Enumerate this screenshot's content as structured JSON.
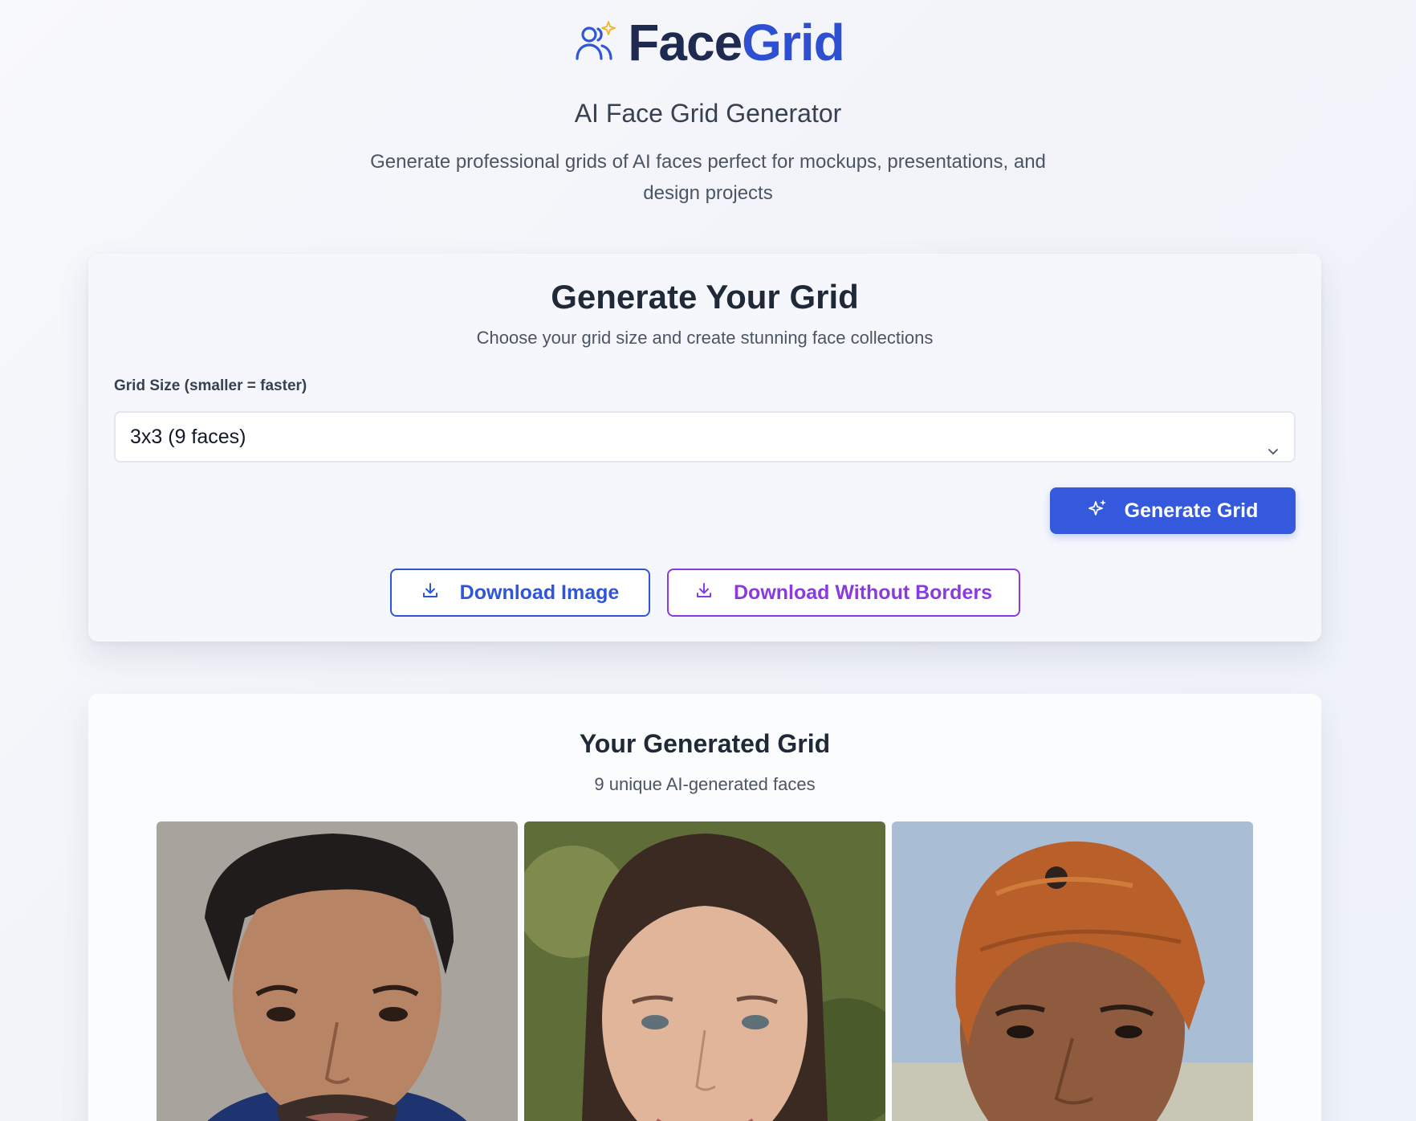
{
  "header": {
    "brand_first": "Face",
    "brand_second": "Grid",
    "tagline": "AI Face Grid Generator",
    "description": "Generate professional grids of AI faces perfect for mockups, presentations, and design projects"
  },
  "generator": {
    "title": "Generate Your Grid",
    "subtitle": "Choose your grid size and create stunning face collections",
    "grid_size_label": "Grid Size (smaller = faster)",
    "grid_size_value": "3x3 (9 faces)",
    "generate_button": "Generate Grid",
    "download_image_button": "Download Image",
    "download_without_borders_button": "Download Without Borders"
  },
  "results": {
    "title": "Your Generated Grid",
    "subtitle": "9 unique AI-generated faces"
  },
  "colors": {
    "primary": "#3559dc",
    "brand_dark": "#1e2a4f",
    "brand_blue": "#2f4fd1",
    "accent_purple": "#8a3be0",
    "sparkle": "#f0b429"
  },
  "icons": {
    "brand": "users-sparkle-icon",
    "select": "chevron-down-icon",
    "generate": "sparkles-icon",
    "download": "download-icon"
  }
}
